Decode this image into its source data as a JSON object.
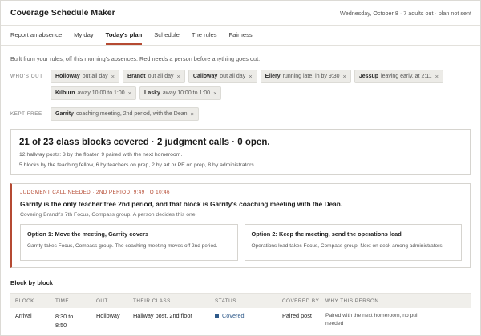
{
  "app": {
    "title": "Coverage Schedule Maker",
    "status": "Wednesday, October 8 · 7 adults out · plan not sent"
  },
  "tabs": [
    {
      "label": "Report an absence"
    },
    {
      "label": "My day"
    },
    {
      "label": "Today's plan"
    },
    {
      "label": "Schedule"
    },
    {
      "label": "The rules"
    },
    {
      "label": "Fairness"
    }
  ],
  "intro": "Built from your rules, off this morning's absences. Red needs a person before anything goes out.",
  "whos_out": {
    "label": "WHO'S OUT",
    "chips": [
      {
        "name": "Holloway",
        "detail": "out all day"
      },
      {
        "name": "Brandt",
        "detail": "out all day"
      },
      {
        "name": "Calloway",
        "detail": "out all day"
      },
      {
        "name": "Ellery",
        "detail": "running late, in by 9:30"
      },
      {
        "name": "Jessup",
        "detail": "leaving early, at 2:11"
      },
      {
        "name": "Kilburn",
        "detail": "away 10:00 to 1:00"
      },
      {
        "name": "Lasky",
        "detail": "away 10:00 to 1:00"
      }
    ]
  },
  "kept_free": {
    "label": "KEPT FREE",
    "chips": [
      {
        "name": "Garrity",
        "detail": "coaching meeting, 2nd period, with the Dean"
      }
    ]
  },
  "remove_glyph": "×",
  "summary": {
    "headline": "21 of 23 class blocks covered · 2 judgment calls · 0 open.",
    "line1": "12 hallway posts: 3 by the floater, 9 paired with the next homeroom.",
    "line2": "5 blocks by the teaching fellow, 6 by teachers on prep, 2 by art or PE on prep, 8 by administrators."
  },
  "judgment": {
    "tag": "JUDGMENT CALL NEEDED · 2ND PERIOD, 9:49 TO 10:46",
    "title": "Garrity is the only teacher free 2nd period, and that block is Garrity's coaching meeting with the Dean.",
    "subtitle": "Covering Brandt's 7th Focus, Compass group. A person decides this one.",
    "options": [
      {
        "title": "Option 1: Move the meeting, Garrity covers",
        "body": "Garrity takes Focus, Compass group. The coaching meeting moves off 2nd period."
      },
      {
        "title": "Option 2: Keep the meeting, send the operations lead",
        "body": "Operations lead takes Focus, Compass group. Next on deck among administrators."
      }
    ]
  },
  "table": {
    "title": "Block by block",
    "columns": [
      "BLOCK",
      "TIME",
      "OUT",
      "THEIR CLASS",
      "STATUS",
      "COVERED BY",
      "WHY THIS PERSON"
    ],
    "rows": [
      {
        "block": "Arrival",
        "time_start": "8:30 to",
        "time_end": "8:50",
        "out": "Holloway",
        "their_class": "Hallway post, 2nd floor",
        "status": "Covered",
        "covered_by": "Paired post",
        "why": "Paired with the next homeroom, no pull needed"
      }
    ]
  },
  "colors": {
    "accent": "#b54a32",
    "covered": "#2f5a8a"
  }
}
